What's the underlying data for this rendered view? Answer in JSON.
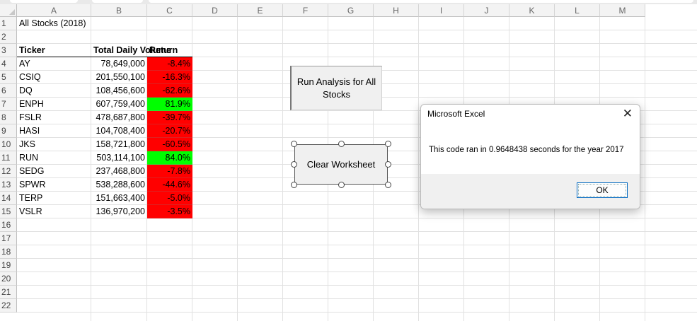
{
  "columns": [
    "A",
    "B",
    "C",
    "D",
    "E",
    "F",
    "G",
    "H",
    "I",
    "J",
    "K",
    "L",
    "M"
  ],
  "rows": [
    "1",
    "2",
    "3",
    "4",
    "5",
    "6",
    "7",
    "8",
    "9",
    "10",
    "11",
    "12",
    "13",
    "14",
    "15",
    "16",
    "17",
    "18",
    "19",
    "20",
    "21",
    "22"
  ],
  "sheet": {
    "title": "All Stocks (2018)",
    "headers": {
      "ticker": "Ticker",
      "volume": "Total Daily Volume",
      "return": "Return"
    },
    "data": [
      {
        "ticker": "AY",
        "volume": "78,649,000",
        "return": "-8.4%",
        "positive": false
      },
      {
        "ticker": "CSIQ",
        "volume": "201,550,100",
        "return": "-16.3%",
        "positive": false
      },
      {
        "ticker": "DQ",
        "volume": "108,456,600",
        "return": "-62.6%",
        "positive": false
      },
      {
        "ticker": "ENPH",
        "volume": "607,759,400",
        "return": "81.9%",
        "positive": true
      },
      {
        "ticker": "FSLR",
        "volume": "478,687,800",
        "return": "-39.7%",
        "positive": false
      },
      {
        "ticker": "HASI",
        "volume": "104,708,400",
        "return": "-20.7%",
        "positive": false
      },
      {
        "ticker": "JKS",
        "volume": "158,721,800",
        "return": "-60.5%",
        "positive": false
      },
      {
        "ticker": "RUN",
        "volume": "503,114,100",
        "return": "84.0%",
        "positive": true
      },
      {
        "ticker": "SEDG",
        "volume": "237,468,800",
        "return": "-7.8%",
        "positive": false
      },
      {
        "ticker": "SPWR",
        "volume": "538,288,600",
        "return": "-44.6%",
        "positive": false
      },
      {
        "ticker": "TERP",
        "volume": "151,663,400",
        "return": "-5.0%",
        "positive": false
      },
      {
        "ticker": "VSLR",
        "volume": "136,970,200",
        "return": "-3.5%",
        "positive": false
      }
    ]
  },
  "buttons": {
    "run_analysis": "Run Analysis for All Stocks",
    "clear_worksheet": "Clear Worksheet"
  },
  "dialog": {
    "title": "Microsoft Excel",
    "close_glyph": "✕",
    "message": "This code ran in 0.9648438 seconds for the year 2017",
    "ok_label": "OK"
  },
  "colors": {
    "positive": "#00ff00",
    "negative": "#ff0000"
  }
}
